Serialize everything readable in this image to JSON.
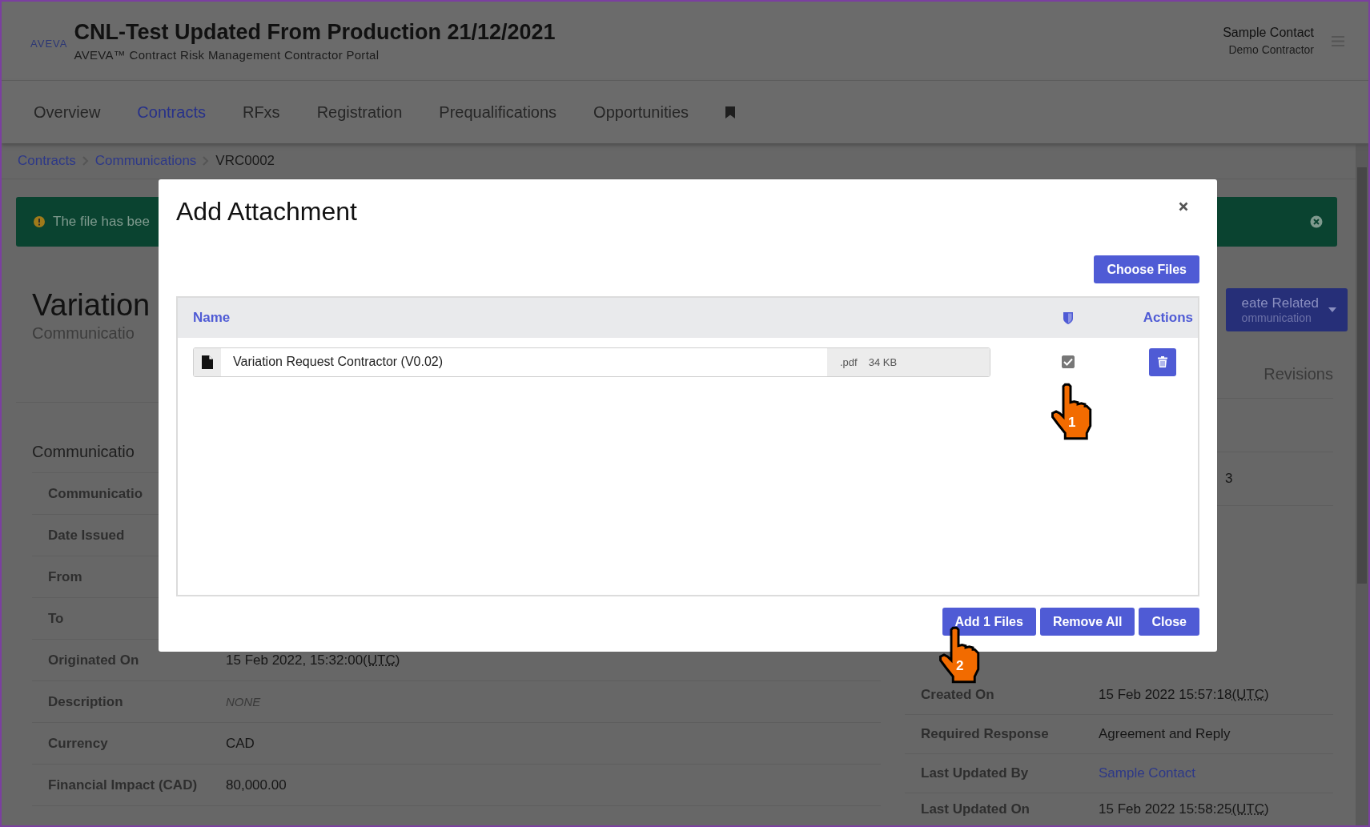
{
  "header": {
    "logo": "AVEVA",
    "title": "CNL-Test Updated From Production 21/12/2021",
    "subtitle": "AVEVA™ Contract Risk Management Contractor Portal",
    "user": "Sample Contact",
    "organisation": "Demo Contractor"
  },
  "nav": {
    "tabs": [
      {
        "label": "Overview",
        "selected": false
      },
      {
        "label": "Contracts",
        "selected": true
      },
      {
        "label": "RFxs",
        "selected": false
      },
      {
        "label": "Registration",
        "selected": false
      },
      {
        "label": "Prequalifications",
        "selected": false
      },
      {
        "label": "Opportunities",
        "selected": false
      }
    ]
  },
  "breadcrumb": [
    "Contracts",
    "Communications",
    "VRC0002"
  ],
  "alert": {
    "text": "The file has bee"
  },
  "page_title": "Variation",
  "page_subtitle": "Communicatio",
  "create_related": {
    "line_1": "eate Related",
    "line_2": "ommunication"
  },
  "revisions_tab": {
    "label": "Revisions"
  },
  "details": {
    "heading": "Communicatio",
    "rows": [
      {
        "label": "Communicatio",
        "kind": "hidden"
      },
      {
        "label": "Date Issued",
        "kind": "hidden"
      },
      {
        "label": "From",
        "kind": "hidden"
      },
      {
        "label": "To",
        "kind": "hidden"
      },
      {
        "label": "Originated On",
        "kind": "text",
        "value": "15 Feb 2022, 15:32:00",
        "tz": "(UTC)"
      },
      {
        "label": "Description",
        "kind": "empty",
        "value": "NONE"
      },
      {
        "label": "Currency",
        "kind": "text",
        "value": "CAD"
      },
      {
        "label": "Financial Impact (CAD)",
        "kind": "text",
        "value": "80,000.00"
      }
    ]
  },
  "side_details": {
    "partial_value": "3",
    "rows": [
      {
        "label": "Created On",
        "kind": "text",
        "value": "15 Feb 2022 15:57:18",
        "tz": "(UTC)"
      },
      {
        "label": "Required Response",
        "kind": "text",
        "value": "Agreement and Reply"
      },
      {
        "label": "Last Updated By",
        "kind": "link",
        "value": "Sample Contact"
      },
      {
        "label": "Last Updated On",
        "kind": "text",
        "value": "15 Feb 2022 15:58:25",
        "tz": "(UTC)"
      }
    ]
  },
  "modal": {
    "title": "Add Attachment",
    "choose_files": "Choose Files",
    "name_header": "Name",
    "actions_header": "Actions",
    "files": [
      {
        "name": "Variation Request Contractor (V0.02)",
        "extension": ".pdf",
        "size": "34 KB",
        "checked": true
      }
    ],
    "buttons": [
      "Add 1 Files",
      "Remove All",
      "Close"
    ]
  },
  "annotations": [
    {
      "number": "1"
    },
    {
      "number": "2"
    }
  ]
}
